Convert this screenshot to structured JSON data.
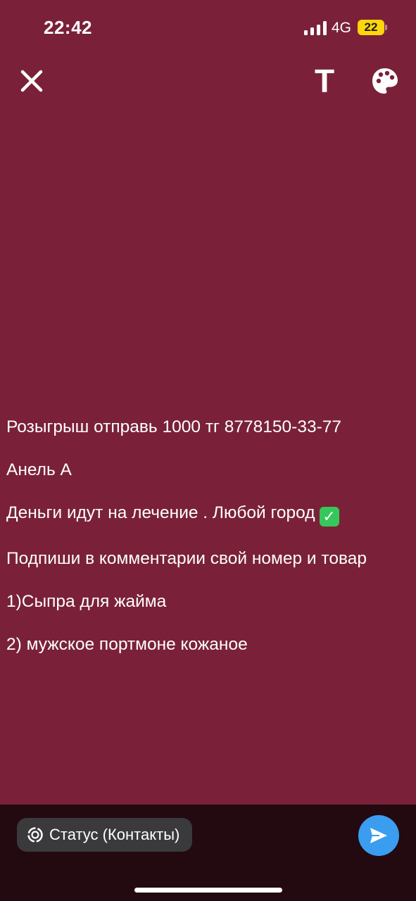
{
  "status_bar": {
    "time": "22:42",
    "network": "4G",
    "battery": "22"
  },
  "toolbar": {
    "text_tool": "T"
  },
  "story": {
    "lines": [
      "Розыгрыш отправь 1000 тг 8778150-33-77",
      "Анель А",
      "Деньги идут на лечение . Любой город",
      "Подпиши в комментарии свой номер и товар",
      "1)Сыпра для жайма",
      "2) мужское портмоне кожаное"
    ],
    "check_emoji": "✓"
  },
  "bottom": {
    "audience_label": "Статус (Контакты)"
  },
  "colors": {
    "background": "#7a2139",
    "bottom_bar": "#230910",
    "send": "#3b9df0",
    "battery": "#ffd60a"
  },
  "icons": [
    "signal-icon",
    "close-icon",
    "text-tool-icon",
    "palette-icon",
    "status-ring-icon",
    "send-icon"
  ]
}
